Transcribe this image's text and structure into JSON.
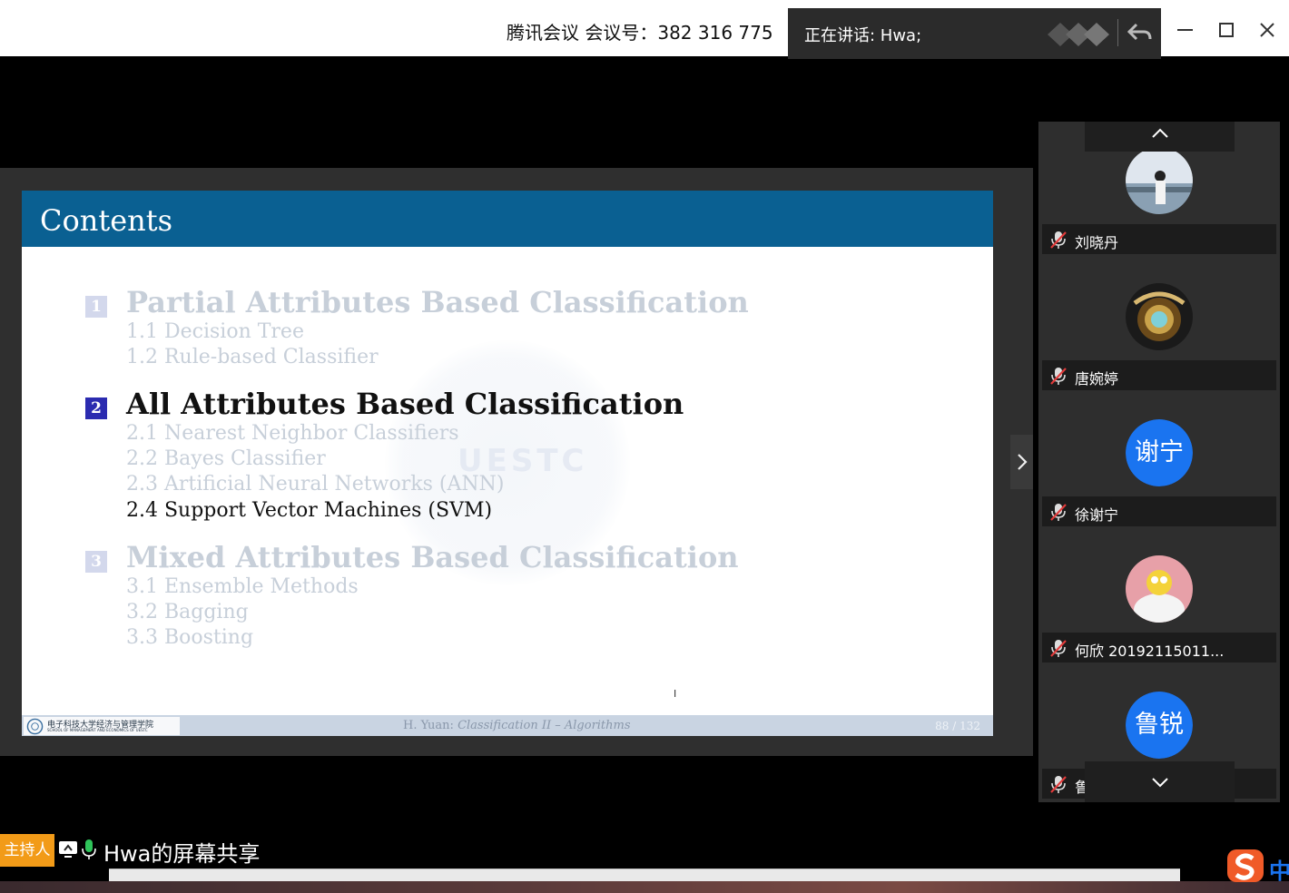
{
  "titlebar": {
    "meeting_info": "腾讯会议 会议号：382 316 775",
    "speaking": "正在讲话: Hwa;"
  },
  "slide": {
    "header_title": "Contents",
    "watermark_text": "UESTC",
    "sections": [
      {
        "number": "1",
        "title": "Partial Attributes Based Classification",
        "state": "dim",
        "items": [
          "1.1 Decision Tree",
          "1.2 Rule-based Classifier"
        ]
      },
      {
        "number": "2",
        "title": "All Attributes Based Classification",
        "state": "active",
        "items": [
          "2.1 Nearest Neighbor Classifiers",
          "2.2 Bayes Classifier",
          "2.3 Artificial Neural Networks (ANN)",
          "2.4 Support Vector Machines (SVM)"
        ],
        "active_item": 3
      },
      {
        "number": "3",
        "title": "Mixed Attributes Based Classification",
        "state": "dim",
        "items": [
          "3.1 Ensemble Methods",
          "3.2 Bagging",
          "3.3 Boosting"
        ]
      }
    ],
    "footer": {
      "logo_text": "电子科技大学经济与管理学院",
      "logo_sub": "SCHOOL OF MANAGEMENT AND ECONOMICS OF UESTC",
      "center_prefix": "H. Yuan: ",
      "center_italic": "Classification II – Algorithms",
      "page": "88 / 132"
    },
    "cursor": "I"
  },
  "participants": [
    {
      "name": "刘晓丹",
      "avatar": "photo-woman-seaside",
      "muted": true
    },
    {
      "name": "唐婉婷",
      "avatar": "badge-happy-new-year",
      "muted": true
    },
    {
      "name": "徐谢宁",
      "avatar_text": "谢宁",
      "muted": true
    },
    {
      "name": "何欣 20192115011...",
      "avatar": "cartoon-homer",
      "muted": true
    },
    {
      "name": "鲁锐",
      "avatar_text": "鲁锐",
      "muted": true
    }
  ],
  "bottom": {
    "host_tag": "主持人",
    "share_label": "Hwa的屏幕共享",
    "ime_label": "中"
  },
  "colors": {
    "slide_header": "#0a6092",
    "active_number": "#2b2bb0",
    "dim_text": "#c7cfd9",
    "host_tag": "#f29b18",
    "avatar_blue": "#1a74f0"
  }
}
